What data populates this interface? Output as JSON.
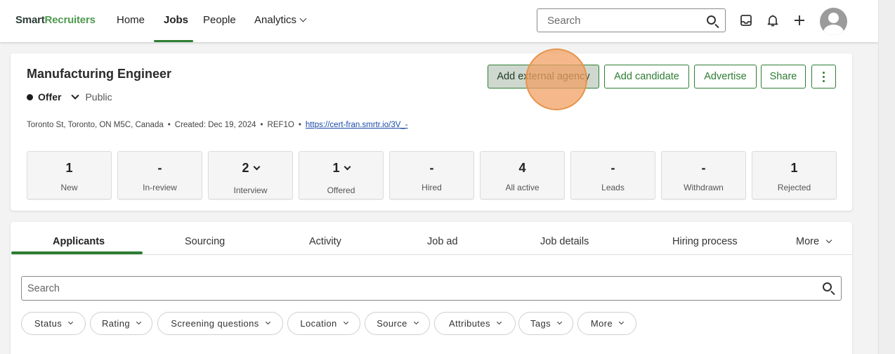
{
  "nav": {
    "logo_part1": "Smart",
    "logo_part2": "Recruiters",
    "items": [
      {
        "label": "Home"
      },
      {
        "label": "Jobs"
      },
      {
        "label": "People"
      },
      {
        "label": "Analytics"
      }
    ],
    "active": "Jobs",
    "search_placeholder": "Search",
    "icons": [
      "inbox-icon",
      "bell-icon",
      "plus-icon",
      "avatar"
    ]
  },
  "job": {
    "title": "Manufacturing Engineer",
    "status": "Offer",
    "visibility": "Public",
    "location": "Toronto St, Toronto, ON M5C, Canada",
    "created": "Created: Dec 19, 2024",
    "ref": "REF1O",
    "link": "https://cert-fran.smrtr.io/3V_-",
    "separator": "•"
  },
  "actions": {
    "add_agency": "Add external agency",
    "add_candidate": "Add candidate",
    "advertise": "Advertise",
    "share": "Share"
  },
  "stats": [
    {
      "value": "1",
      "label": "New"
    },
    {
      "value": "-",
      "label": "In-review"
    },
    {
      "value": "2",
      "label": "Interview"
    },
    {
      "value": "1",
      "label": "Offered"
    },
    {
      "value": "-",
      "label": "Hired"
    },
    {
      "value": "4",
      "label": "All active"
    },
    {
      "value": "-",
      "label": "Leads"
    },
    {
      "value": "-",
      "label": "Withdrawn"
    },
    {
      "value": "1",
      "label": "Rejected"
    }
  ],
  "tabs": [
    {
      "label": "Applicants"
    },
    {
      "label": "Sourcing"
    },
    {
      "label": "Activity"
    },
    {
      "label": "Job ad"
    },
    {
      "label": "Job details"
    },
    {
      "label": "Hiring process"
    },
    {
      "label": "More"
    }
  ],
  "active_tab": "Applicants",
  "applicant_search_placeholder": "Search",
  "filters": [
    {
      "label": "Status"
    },
    {
      "label": "Rating"
    },
    {
      "label": "Screening questions"
    },
    {
      "label": "Location"
    },
    {
      "label": "Source"
    },
    {
      "label": "Attributes"
    },
    {
      "label": "Tags"
    },
    {
      "label": "More"
    }
  ],
  "colors": {
    "brand_green": "#2e7d32",
    "logo_dark": "#2b3c36",
    "logo_green": "#4f9a4f",
    "link_blue": "#1a4aa8",
    "click_marker": "#f0a064"
  }
}
